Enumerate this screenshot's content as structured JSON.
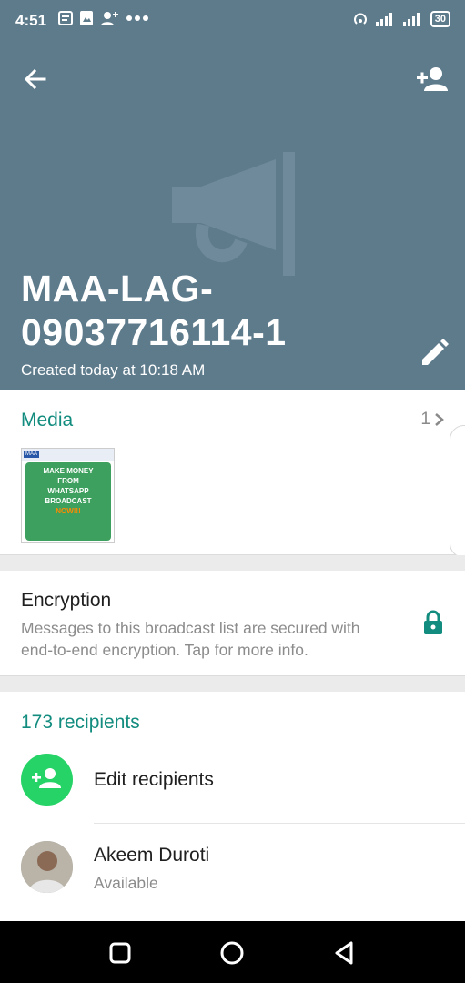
{
  "status_bar": {
    "time": "4:51",
    "battery": "30",
    "left_icons": [
      "notes-icon",
      "image-icon",
      "add-person-icon",
      "more-dots-icon"
    ],
    "right_icons": [
      "hotspot-icon",
      "signal-icon",
      "signal-icon",
      "battery-icon"
    ]
  },
  "header": {
    "title": "MAA-LAG-09037716114-1",
    "created": "Created today at 10:18 AM",
    "background_color": "#5e7b8c",
    "icons": [
      "back-arrow-icon",
      "add-person-icon",
      "megaphone-icon",
      "pencil-icon"
    ]
  },
  "media": {
    "label": "Media",
    "count": "1",
    "thumbnail": {
      "header_text": "MAA",
      "lines": [
        "MAKE MONEY",
        "FROM",
        "WHATSAPP",
        "BROADCAST"
      ],
      "highlight": "NOW!!!"
    }
  },
  "encryption": {
    "title": "Encryption",
    "description": "Messages to this broadcast list are secured with end-to-end encryption. Tap for more info."
  },
  "recipients": {
    "count_label": "173 recipients",
    "edit_label": "Edit recipients",
    "contact": {
      "name": "Akeem Duroti",
      "status": "Available"
    }
  },
  "colors": {
    "accent": "#128c7e",
    "green": "#25d366"
  }
}
